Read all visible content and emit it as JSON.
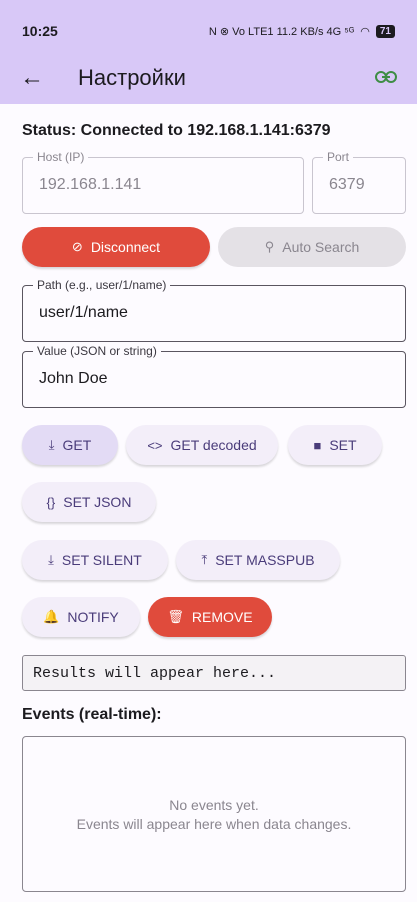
{
  "status_bar": {
    "time": "10:25",
    "icons": "N ⊗ Vo LTE1 11.2 KB/s 4G ⁵ᴳ",
    "battery": "71"
  },
  "app_bar": {
    "title": "Настройки"
  },
  "connection": {
    "status": "Status: Connected to 192.168.1.141:6379",
    "host_label": "Host (IP)",
    "host_value": "192.168.1.141",
    "port_label": "Port",
    "port_value": "6379",
    "disconnect_label": "Disconnect",
    "auto_search_label": "Auto Search"
  },
  "path": {
    "label": "Path (e.g., user/1/name)",
    "value": "user/1/name"
  },
  "value": {
    "label": "Value (JSON or string)",
    "value": "John Doe"
  },
  "actions": {
    "get": "GET",
    "get_decoded": "GET decoded",
    "set": "SET",
    "set_json": "SET JSON",
    "set_silent": "SET SILENT",
    "set_masspub": "SET MASSPUB",
    "notify": "NOTIFY",
    "remove": "REMOVE"
  },
  "result": {
    "text": "Results will appear here..."
  },
  "events": {
    "title": "Events (real-time):",
    "empty_line1": "No events yet.",
    "empty_line2": "Events will appear here when data changes."
  },
  "colors": {
    "app_bar": "#d8c8f7",
    "danger": "#e04b3c",
    "link": "#3e8d45"
  }
}
